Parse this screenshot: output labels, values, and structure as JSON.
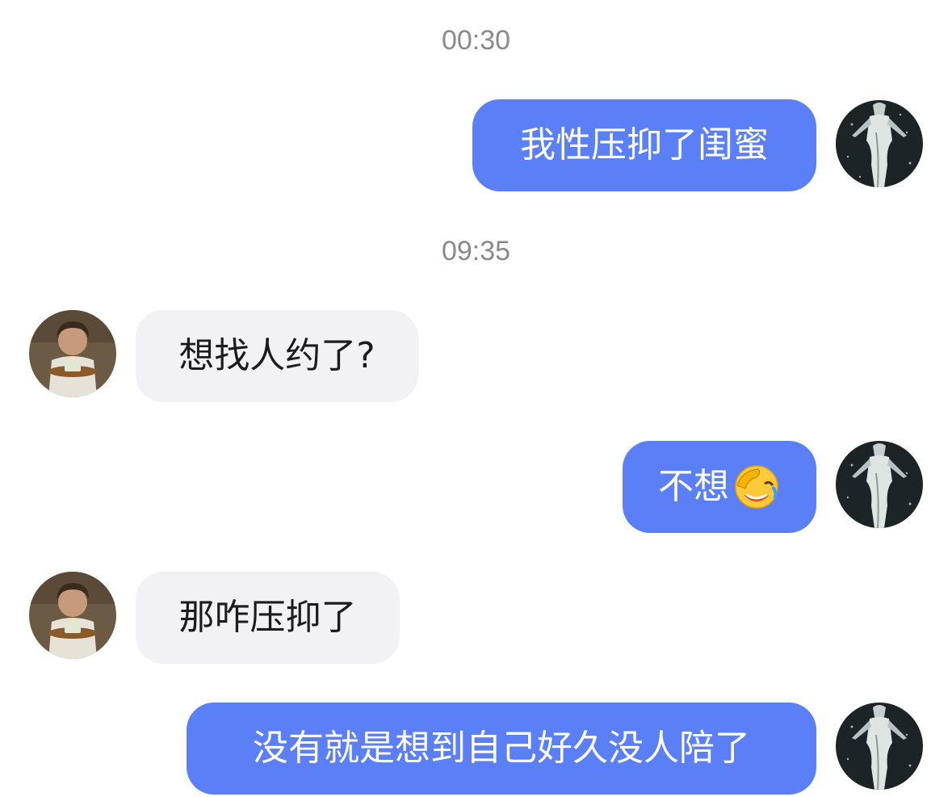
{
  "colors": {
    "my_bubble": "#5b7ff7",
    "their_bubble": "#f2f2f4",
    "timestamp_text": "#8a8a8e"
  },
  "timestamps": [
    "00:30",
    "09:35"
  ],
  "messages": [
    {
      "sender": "me",
      "text": "我性压抑了闺蜜"
    },
    {
      "sender": "them",
      "text": "想找人约了?"
    },
    {
      "sender": "me",
      "text": "不想",
      "emoji": "facepalm-laugh-emoji"
    },
    {
      "sender": "them",
      "text": "那咋压抑了"
    },
    {
      "sender": "me",
      "text": "没有就是想到自己好久没人陪了"
    }
  ],
  "avatars": {
    "me": "silhouette-figure-avatar",
    "them": "boy-with-cake-avatar"
  }
}
